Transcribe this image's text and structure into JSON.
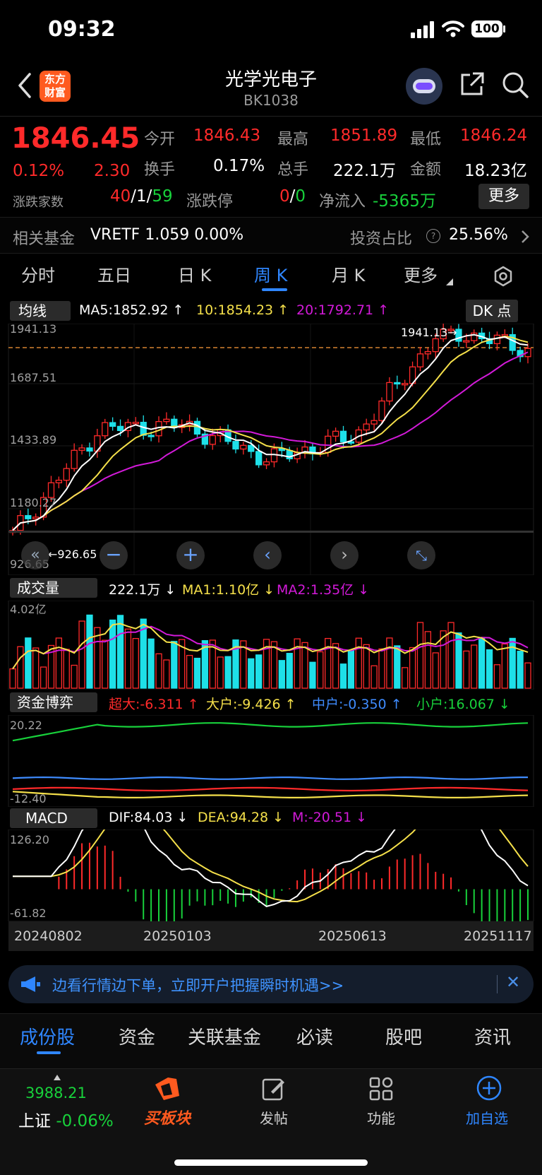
{
  "status_bar": {
    "time": "09:32",
    "battery": "100"
  },
  "header": {
    "title": "光学光电子",
    "code": "BK1038",
    "logo_line1": "东方",
    "logo_line2": "财富"
  },
  "quote": {
    "price": "1846.45",
    "pct": "0.12%",
    "change": "2.30",
    "open_label": "今开",
    "open": "1846.43",
    "high_label": "最高",
    "high": "1851.89",
    "low_label": "最低",
    "low": "1846.24",
    "turnover_label": "换手",
    "turnover": "0.17%",
    "volume_label": "总手",
    "volume": "222.1万",
    "amount_label": "金额",
    "amount": "18.23亿",
    "breadth_label": "涨跌家数",
    "up": "40",
    "flat": "1",
    "down": "59",
    "slash": "/",
    "limit_label": "涨跌停",
    "limit_up": "0",
    "limit_down": "0",
    "netflow_label": "净流入",
    "netflow": "-5365万",
    "more_button": "更多"
  },
  "fund": {
    "label": "相关基金",
    "text": "VRETF 1.059 0.00%",
    "ratio_label": "投资占比",
    "ratio": "25.56%"
  },
  "period_tabs": [
    "分时",
    "五日",
    "日 K",
    "周 K",
    "月 K",
    "更多"
  ],
  "active_tab": 3,
  "ma_bar": {
    "selector": "均线",
    "ma5": "MA5:1852.92 ↑",
    "ma10": "10:1854.23 ↑",
    "ma20": "20:1792.71 ↑",
    "dk_button": "DK 点"
  },
  "price_axis": {
    "labels": [
      "1941.13",
      "1687.51",
      "1433.89",
      "1180.27",
      "926.65"
    ],
    "top_marker": "1941.13→",
    "low_marker": "←926.65"
  },
  "volume_bar": {
    "selector": "成交量",
    "vol": "222.1万 ↓",
    "ma1": "MA1:1.10亿 ↓",
    "ma2": "MA2:1.35亿 ↓",
    "axis_top": "4.02亿"
  },
  "capital_bar": {
    "selector": "资金博弈",
    "super": "超大:-6.311 ↑",
    "large": "大户:-9.426 ↑",
    "medium": "中户:-0.350 ↑",
    "small": "小户:16.067 ↓",
    "axis_top": "20.22",
    "axis_bottom": "-12.40"
  },
  "macd_bar": {
    "selector": "MACD",
    "dif": "DIF:84.03 ↓",
    "dea": "DEA:94.28 ↓",
    "m": "M:-20.51 ↓",
    "axis_top": "126.20",
    "axis_bottom": "-61.82"
  },
  "dates": [
    "20240802",
    "20250103",
    "20250613",
    "20251117"
  ],
  "banner": {
    "text": "边看行情边下单，立即开户把握瞬时机遇>>"
  },
  "bottom_tabs": [
    "成份股",
    "资金",
    "关联基金",
    "必读",
    "股吧",
    "资讯"
  ],
  "bottom_nav": {
    "index_value": "3988.21",
    "index_name": "上证",
    "index_pct": "-0.06%",
    "buy": "买板块",
    "post": "发帖",
    "func": "功能",
    "add": "加自选"
  },
  "colors": {
    "up": "#ff2a2a",
    "down": "#1ee0e8",
    "ma5": "#ffffff",
    "ma10": "#f5e04a",
    "ma20": "#d21ad8",
    "accent": "#2f86ff"
  },
  "chart_data": [
    {
      "type": "candlestick",
      "title": "",
      "x_range": [
        "20240802",
        "20251117"
      ],
      "ylim": [
        926.65,
        1941.13
      ],
      "summary_points": [
        {
          "x": "20240802",
          "close": 930
        },
        {
          "x": "20241004",
          "close": 1450
        },
        {
          "x": "20250103",
          "close": 1470
        },
        {
          "x": "20250404",
          "close": 1300
        },
        {
          "x": "20250613",
          "close": 1420
        },
        {
          "x": "20251010",
          "close": 1941.13
        },
        {
          "x": "20251117",
          "close": 1846.45
        }
      ]
    },
    {
      "type": "bar",
      "title": "",
      "ylim": [
        0,
        4.02
      ],
      "y_unit": "亿"
    },
    {
      "type": "line",
      "title": "",
      "ylim": [
        -12.4,
        20.22
      ]
    },
    {
      "type": "bar",
      "title": "",
      "ylim": [
        -61.82,
        126.2
      ]
    }
  ]
}
